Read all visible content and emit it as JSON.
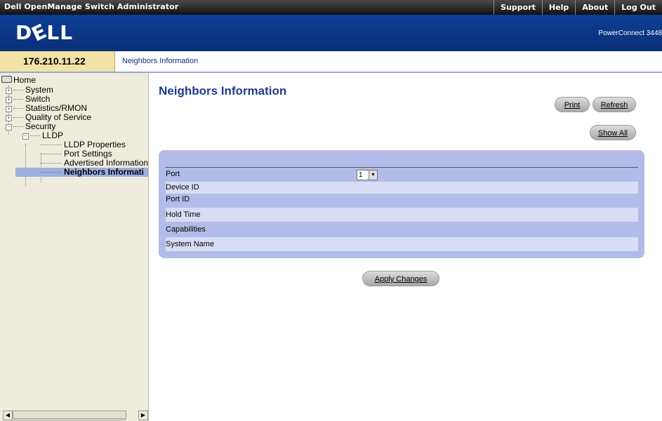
{
  "app_title": "Dell OpenManage Switch Administrator",
  "top_nav": [
    "Support",
    "Help",
    "About",
    "Log Out"
  ],
  "brand": {
    "logo_text": "DELL",
    "product": "PowerConnect 3448"
  },
  "address_bar": {
    "ip": "176.210.11.22",
    "breadcrumb": "Neighbors Information"
  },
  "tree": {
    "home": "Home",
    "items": [
      "System",
      "Switch",
      "Statistics/RMON",
      "Quality of Service",
      "Security"
    ],
    "lldp": "LLDP",
    "lldp_children": [
      "LLDP Properties",
      "Port Settings",
      "Advertised Information",
      "Neighbors Informati"
    ],
    "selected": "Neighbors Informati"
  },
  "page": {
    "title": "Neighbors Information",
    "buttons": {
      "print": "Print",
      "refresh": "Refresh",
      "show_all": "Show All",
      "apply": "Apply Changes"
    },
    "port_label": "Port",
    "port_value": "1",
    "fields": [
      "Device ID",
      "Port ID",
      "Hold Time",
      "Capabilities",
      "System Name"
    ]
  },
  "colors": {
    "banner": "#0b3c8f",
    "panel": "#b3bce8",
    "title": "#1f3c8f",
    "ip_box": "#f3e2a6"
  }
}
